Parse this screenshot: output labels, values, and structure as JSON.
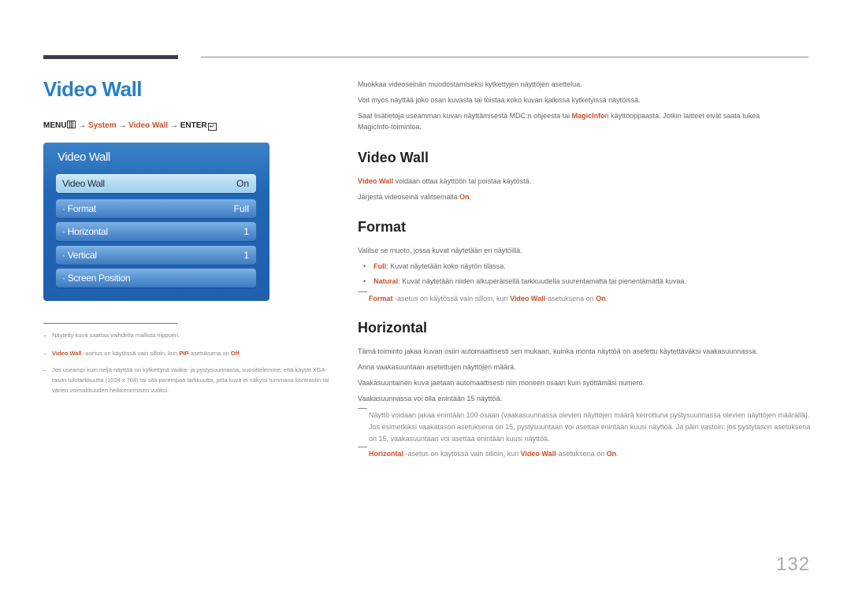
{
  "page": {
    "title": "Video Wall",
    "page_number": "132"
  },
  "menu_path": {
    "menu": "MENU",
    "arrow": "→",
    "system": "System",
    "video_wall": "Video Wall",
    "enter": "ENTER",
    "enter_glyph": "↵"
  },
  "osd": {
    "title": "Video Wall",
    "items": [
      {
        "label": "Video Wall",
        "value": "On",
        "selected": true
      },
      {
        "label": "· Format",
        "value": "Full"
      },
      {
        "label": "· Horizontal",
        "value": "1"
      },
      {
        "label": "· Vertical",
        "value": "1"
      },
      {
        "label": "· Screen Position",
        "value": ""
      }
    ]
  },
  "footnotes": {
    "dash": "–",
    "n1": "Näytetty kuva saattaa vaihdella mallista riippuen.",
    "n2": {
      "a": "Video Wall",
      "b": " -asetus on käytössä vain silloin, kun ",
      "c": "PIP",
      "d": "-asetuksena on ",
      "e": "Off",
      "f": "."
    },
    "n3": "Jos useampi kuin neljä näyttöä on kytkettynä vaaka- ja pystysuunnassa, suosittelemme, että käytät XGA-tason tulotarkkuutta (1024 x 768) tai sitä parempaa tarkkuutta, jotta kuva ei näkyisi tummana kontrastin tai värien voimakkuuden heikkenemisen vuoksi."
  },
  "intro": {
    "p1": "Muokkaa videoseinän muodostamiseksi kytkettyjen näyttöjen asettelua.",
    "p2": "Voit myös näyttää joko osan kuvasta tai toistaa koko kuvan kaikissa kytketyissä näytöissä.",
    "p3a": "Saat lisätietoja useamman kuvan näyttämisestä MDC:n ohjeesta tai ",
    "p3b": "MagicInfo",
    "p3c": "n käyttöoppaasta. Jotkin laitteet eivät saata tukea",
    "p3d": "MagicInfo-toimintoa."
  },
  "section_video_wall": {
    "heading": "Video Wall",
    "p1a": "Video Wall",
    "p1b": " voidaan ottaa käyttöön tai poistaa käytöstä.",
    "p2a": "Järjestä videoseinä valitsemalla ",
    "p2b": "On",
    "p2c": "."
  },
  "section_format": {
    "heading": "Format",
    "p1": "Valitse se muoto, jossa kuvat näytetään eri näytöillä.",
    "bullet": "•",
    "b1a": "Full",
    "b1b": ": Kuvat näytetään koko näytön tilassa.",
    "b2a": "Natural",
    "b2b": ": Kuvat näytetään niiden alkuperäisellä tarkkuudella suurentamatta tai pienentämättä kuvaa.",
    "note": {
      "a": "Format",
      "b": " -asetus on käytössä vain silloin, kun ",
      "c": "Video Wall",
      "d": "-asetuksena on ",
      "e": "On",
      "f": "."
    }
  },
  "section_horizontal": {
    "heading": "Horizontal",
    "p1": "Tämä toiminto jakaa kuvan osiin automaattisesti sen mukaan, kuinka monta näyttöä on asetettu käytettäväksi vaakasuunnassa.",
    "p2": "Anna vaakasuuntaan asetettujen näyttöjen määrä.",
    "p3": "Vaakasuuntainen kuva jaetaan automaattisesti niin moneen osaan kuin syöttämäsi numero.",
    "p4": "Vaakasuunnassa voi olla enintään 15 näyttöä.",
    "note1": "Näyttö voidaan jakaa enintään 100 osaan (vaakasuunnassa olevien näyttöjen määrä kerrottuna pystysuunnassa olevien näyttöjen määrällä). Jos esimerkiksi vaakatason asetuksena on 15, pystysuuntaan voi asettaa enintään kuusi näyttöä. Ja päin vastoin: jos pystytason asetuksena on 15, vaakasuuntaan voi asettaa enintään kuusi näyttöä.",
    "note2": {
      "a": "Horizontal",
      "b": " -asetus on käytössä vain silloin, kun ",
      "c": "Video Wall",
      "d": "-asetuksena on ",
      "e": "On",
      "f": "."
    }
  }
}
